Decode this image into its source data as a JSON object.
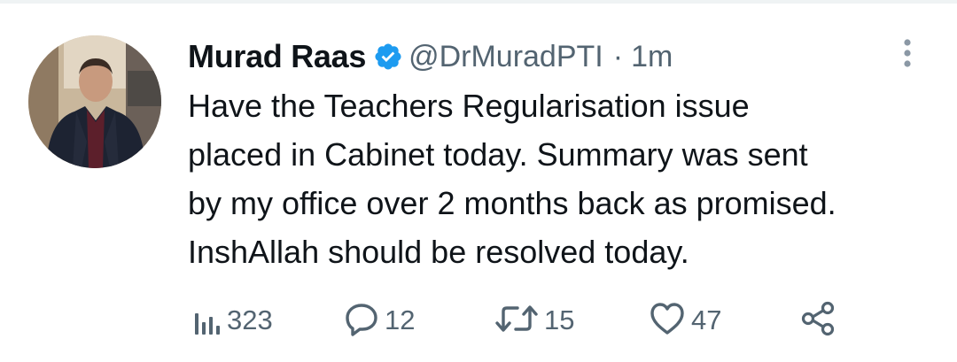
{
  "tweet": {
    "author": {
      "name": "Murad Raas",
      "handle": "@DrMuradPTI",
      "verified": true,
      "avatar": "profile-photo"
    },
    "separator": "·",
    "timestamp": "1m",
    "text_lines": [
      "Have the Teachers Regularisation issue",
      "placed in Cabinet today. Summary was sent",
      "by my office over 2 months back as promised.",
      "InshAllah should be resolved today."
    ],
    "actions": {
      "views": {
        "icon": "analytics-icon",
        "count": "323"
      },
      "replies": {
        "icon": "reply-icon",
        "count": "12"
      },
      "retweets": {
        "icon": "retweet-icon",
        "count": "15"
      },
      "likes": {
        "icon": "heart-icon",
        "count": "47"
      },
      "share": {
        "icon": "share-icon"
      }
    },
    "more_icon": "more-vertical-icon"
  },
  "colors": {
    "text_primary": "#0f1419",
    "text_secondary": "#536471",
    "verified_blue": "#1d9bf0",
    "divider": "#eff3f4"
  }
}
